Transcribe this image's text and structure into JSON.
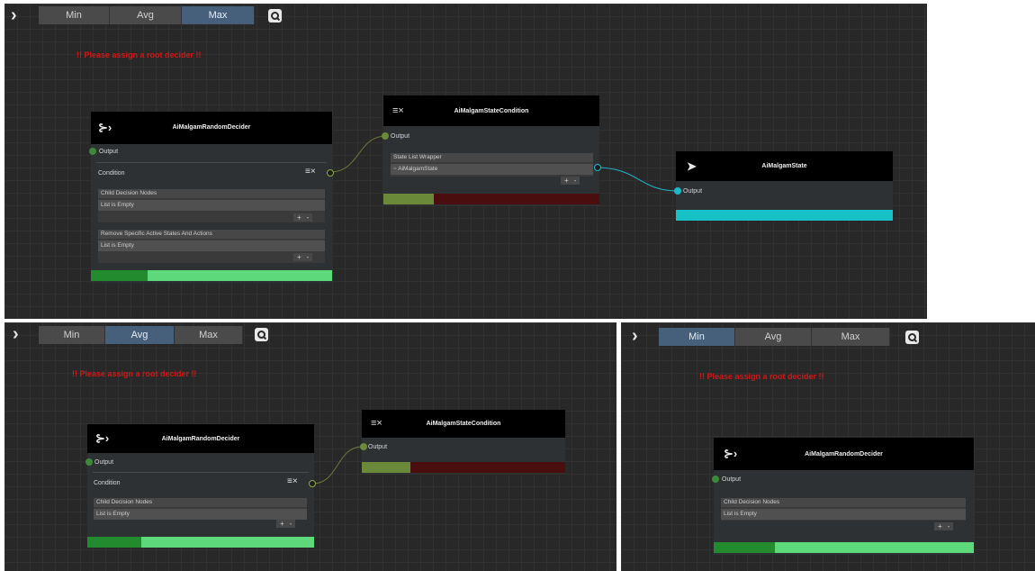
{
  "panels": [
    {
      "toolbar": {
        "expand_glyph": "›",
        "buttons": [
          "Min",
          "Avg",
          "Max"
        ],
        "active": "Max"
      },
      "warning": "!! Please assign a root decider !!",
      "decider": {
        "title": "AiMalgamRandomDecider",
        "output_label": "Output",
        "condition_label": "Condition",
        "list1": {
          "header": "Child Decision Nodes",
          "row": "List is Empty",
          "plus": "+",
          "minus": "-"
        },
        "list2": {
          "header": "Remove Specific Active States And Actions",
          "row": "List is Empty",
          "plus": "+",
          "minus": "-"
        }
      },
      "condition": {
        "title": "AiMalgamStateCondition",
        "output_label": "Output",
        "list": {
          "header": "State List Wrapper",
          "row": "AiMalgamState",
          "plus": "+",
          "minus": "-"
        }
      },
      "state": {
        "title": "AiMalgamState",
        "output_label": "Output"
      }
    },
    {
      "toolbar": {
        "expand_glyph": "›",
        "buttons": [
          "Min",
          "Avg",
          "Max"
        ],
        "active": "Avg"
      },
      "warning": "!! Please assign a root decider !!",
      "decider": {
        "title": "AiMalgamRandomDecider",
        "output_label": "Output",
        "condition_label": "Condition",
        "list1": {
          "header": "Child Decision Nodes",
          "row": "List is Empty",
          "plus": "+",
          "minus": "-"
        }
      },
      "condition": {
        "title": "AiMalgamStateCondition",
        "output_label": "Output"
      }
    },
    {
      "toolbar": {
        "expand_glyph": "›",
        "buttons": [
          "Min",
          "Avg",
          "Max"
        ],
        "active": "Min"
      },
      "warning": "!! Please assign a root decider !!",
      "decider": {
        "title": "AiMalgamRandomDecider",
        "output_label": "Output",
        "list1": {
          "header": "Child Decision Nodes",
          "row": "List is Empty",
          "plus": "+",
          "minus": "-"
        }
      }
    }
  ],
  "icons": {
    "expand": "chevron-right-icon",
    "search": "search-icon",
    "decider": "random-split-icon",
    "condition": "condition-list-icon",
    "state": "state-arrow-icon"
  },
  "colors": {
    "active_button": "#46607c",
    "warning": "#d01818",
    "port_green": "#3a8a3a",
    "port_cyan": "#1fb8c8",
    "bar_dark_green": "#228b2e",
    "bar_light_green": "#5dd87a",
    "bar_olive": "#6a8a3a",
    "bar_dark_red": "#4a0e0e",
    "bar_cyan": "#17c1c8"
  }
}
